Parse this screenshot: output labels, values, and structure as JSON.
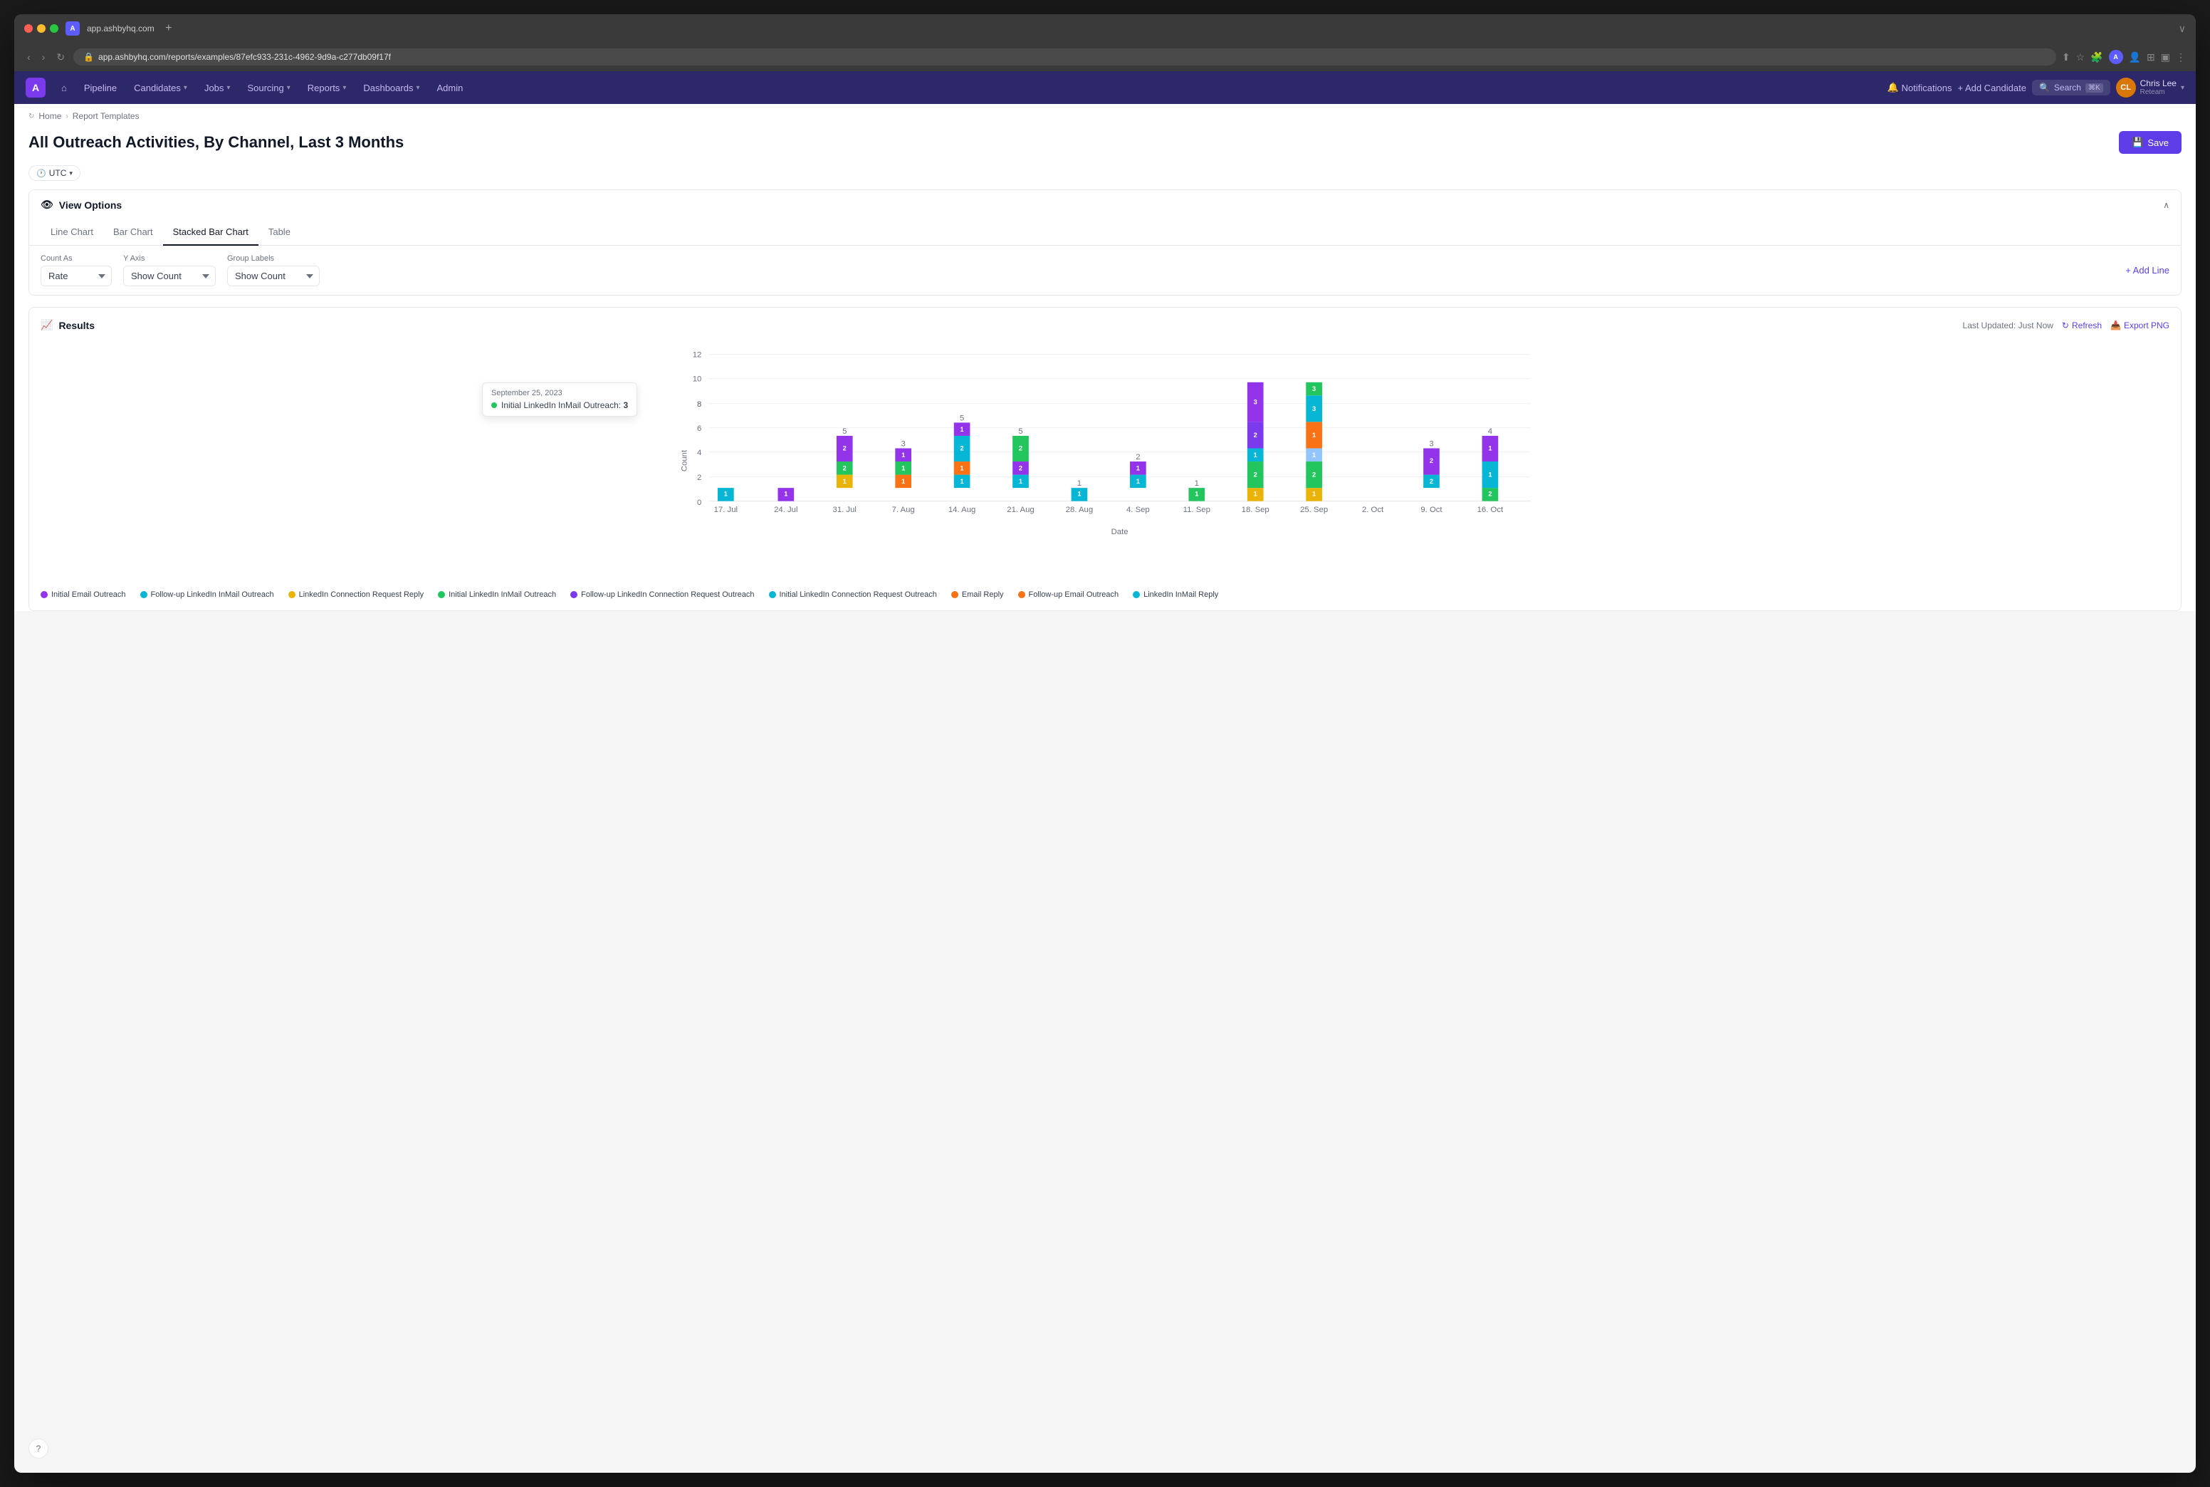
{
  "browser": {
    "url": "app.ashbyhq.com/reports/examples/87efc933-231c-4962-9d9a-c277db09f17f",
    "tab_label": "A"
  },
  "nav": {
    "logo_letter": "A",
    "items": [
      {
        "label": "Pipeline",
        "has_dropdown": false
      },
      {
        "label": "Candidates",
        "has_dropdown": true
      },
      {
        "label": "Jobs",
        "has_dropdown": true
      },
      {
        "label": "Sourcing",
        "has_dropdown": true
      },
      {
        "label": "Reports",
        "has_dropdown": true
      },
      {
        "label": "Dashboards",
        "has_dropdown": true
      },
      {
        "label": "Admin",
        "has_dropdown": false
      }
    ],
    "notifications_label": "Notifications",
    "add_candidate_label": "+ Add Candidate",
    "search_label": "Search",
    "search_shortcut": "⌘K",
    "user_initials": "CL",
    "user_name": "Chris Lee",
    "user_org": "Reteam"
  },
  "breadcrumb": {
    "home": "Home",
    "parent": "Report Templates"
  },
  "page": {
    "title": "All Outreach Activities, By Channel, Last 3 Months",
    "save_label": "Save",
    "timezone_label": "UTC"
  },
  "view_options": {
    "section_title": "View Options",
    "tabs": [
      "Line Chart",
      "Bar Chart",
      "Stacked Bar Chart",
      "Table"
    ],
    "active_tab": "Stacked Bar Chart",
    "count_as_label": "Count As",
    "count_as_value": "Rate",
    "y_axis_label": "Y Axis",
    "y_axis_value": "Show Count",
    "group_labels_label": "Group Labels",
    "group_labels_value": "Show Count",
    "add_line_label": "+ Add Line"
  },
  "results": {
    "title": "Results",
    "last_updated": "Last Updated: Just Now",
    "refresh_label": "Refresh",
    "export_label": "Export PNG"
  },
  "chart": {
    "x_label": "Date",
    "y_label": "Count",
    "y_max": 12,
    "x_dates": [
      "17. Jul",
      "24. Jul",
      "31. Jul",
      "7. Aug",
      "14. Aug",
      "21. Aug",
      "28. Aug",
      "4. Sep",
      "11. Sep",
      "18. Sep",
      "25. Sep",
      "2. Oct",
      "9. Oct",
      "16. Oct"
    ],
    "tooltip": {
      "date": "September 25, 2023",
      "series": "Initial LinkedIn InMail Outreach",
      "value": "3"
    }
  },
  "legend": [
    {
      "label": "Initial Email Outreach",
      "color": "#9333ea"
    },
    {
      "label": "Follow-up LinkedIn InMail Outreach",
      "color": "#06b6d4"
    },
    {
      "label": "LinkedIn Connection Request Reply",
      "color": "#eab308"
    },
    {
      "label": "Initial LinkedIn InMail Outreach",
      "color": "#22c55e"
    },
    {
      "label": "Follow-up LinkedIn Connection Request Outreach",
      "color": "#7c3aed"
    },
    {
      "label": "Initial LinkedIn Connection Request Outreach",
      "color": "#06b6d4"
    },
    {
      "label": "Email Reply",
      "color": "#f97316"
    },
    {
      "label": "Follow-up Email Outreach",
      "color": "#f97316"
    },
    {
      "label": "LinkedIn InMail Reply",
      "color": "#06b6d4"
    }
  ]
}
